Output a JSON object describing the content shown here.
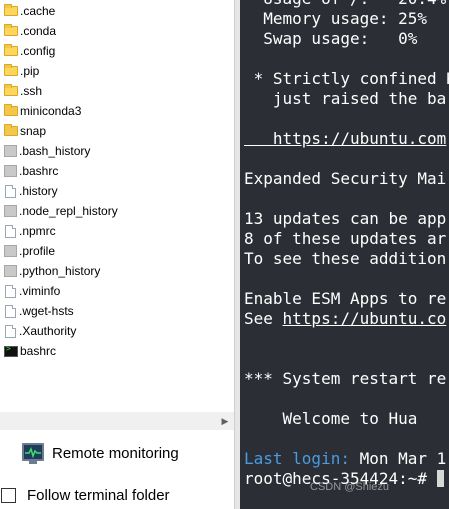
{
  "file_browser": {
    "items": [
      {
        "name": ".cache",
        "icon": "folder-dot-icon"
      },
      {
        "name": ".conda",
        "icon": "folder-dot-icon"
      },
      {
        "name": ".config",
        "icon": "folder-dot-icon"
      },
      {
        "name": ".pip",
        "icon": "folder-dot-icon"
      },
      {
        "name": ".ssh",
        "icon": "folder-dot-icon"
      },
      {
        "name": "miniconda3",
        "icon": "folder-icon"
      },
      {
        "name": "snap",
        "icon": "folder-icon"
      },
      {
        "name": ".bash_history",
        "icon": "file-icon"
      },
      {
        "name": ".bashrc",
        "icon": "file-icon"
      },
      {
        "name": ".history",
        "icon": "document-icon"
      },
      {
        "name": ".node_repl_history",
        "icon": "file-icon"
      },
      {
        "name": ".npmrc",
        "icon": "document-icon"
      },
      {
        "name": ".profile",
        "icon": "file-icon"
      },
      {
        "name": ".python_history",
        "icon": "file-icon"
      },
      {
        "name": ".viminfo",
        "icon": "document-icon"
      },
      {
        "name": ".wget-hsts",
        "icon": "document-icon"
      },
      {
        "name": ".Xauthority",
        "icon": "document-icon"
      },
      {
        "name": "bashrc",
        "icon": "terminal-file-icon"
      }
    ]
  },
  "remote_monitoring": {
    "label": "Remote monitoring",
    "icon": "monitor-icon"
  },
  "follow_terminal": {
    "label": "Follow terminal folder",
    "checked": false
  },
  "terminal": {
    "background": "#2b2e35",
    "lines": [
      {
        "text": "  Usage of /:   20.4%"
      },
      {
        "text": "  Memory usage: 25%"
      },
      {
        "text": "  Swap usage:   0%"
      },
      {
        "text": ""
      },
      {
        "text": " * Strictly confined K"
      },
      {
        "text": "   just raised the bar"
      },
      {
        "text": ""
      },
      {
        "text": "   https://ubuntu.com",
        "link": true
      },
      {
        "text": ""
      },
      {
        "text": "Expanded Security Mai"
      },
      {
        "text": ""
      },
      {
        "text": "13 updates can be app"
      },
      {
        "text": "8 of these updates ar"
      },
      {
        "text": "To see these addition"
      },
      {
        "text": ""
      },
      {
        "text": "Enable ESM Apps to re"
      },
      {
        "text": "See https://ubuntu.co",
        "partial_link": true
      },
      {
        "text": ""
      },
      {
        "text": ""
      },
      {
        "text": "*** System restart re"
      },
      {
        "text": ""
      },
      {
        "text": "    Welcome to Hua"
      },
      {
        "text": ""
      },
      {
        "text": "Last login: Mon Mar 1",
        "blue_prefix": "Last login:"
      },
      {
        "text": "root@hecs-354424:~# ",
        "prompt": true
      }
    ],
    "watermark": "CSDN @Shiezu"
  },
  "colors": {
    "link_blue": "#4a9be0",
    "folder": "#f3c84a"
  }
}
